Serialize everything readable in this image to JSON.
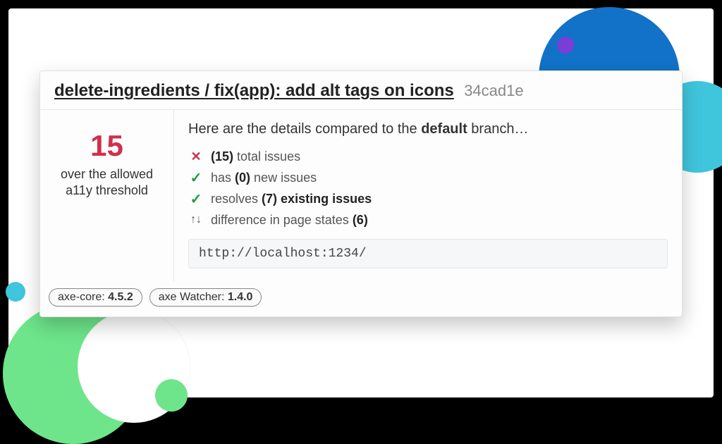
{
  "header": {
    "title": "delete-ingredients / fix(app): add alt tags on icons",
    "hash": "34cad1e"
  },
  "left": {
    "count": "15",
    "caption": "over the allowed a11y threshold"
  },
  "intro": {
    "pre": "Here are the details compared to the ",
    "bold": "default",
    "post": " branch…"
  },
  "issues": {
    "total": {
      "count": "(15)",
      "label": "total issues"
    },
    "new": {
      "pre": "has ",
      "count": "(0)",
      "label": "new issues"
    },
    "resolved": {
      "pre": "resolves ",
      "count": "(7)",
      "label": "existing issues"
    },
    "diff": {
      "pre": "difference in page states ",
      "count": "(6)"
    }
  },
  "url": "http://localhost:1234/",
  "footer": {
    "axe_core": {
      "label": "axe-core: ",
      "version": "4.5.2"
    },
    "axe_watcher": {
      "label": "axe Watcher: ",
      "version": "1.4.0"
    }
  }
}
